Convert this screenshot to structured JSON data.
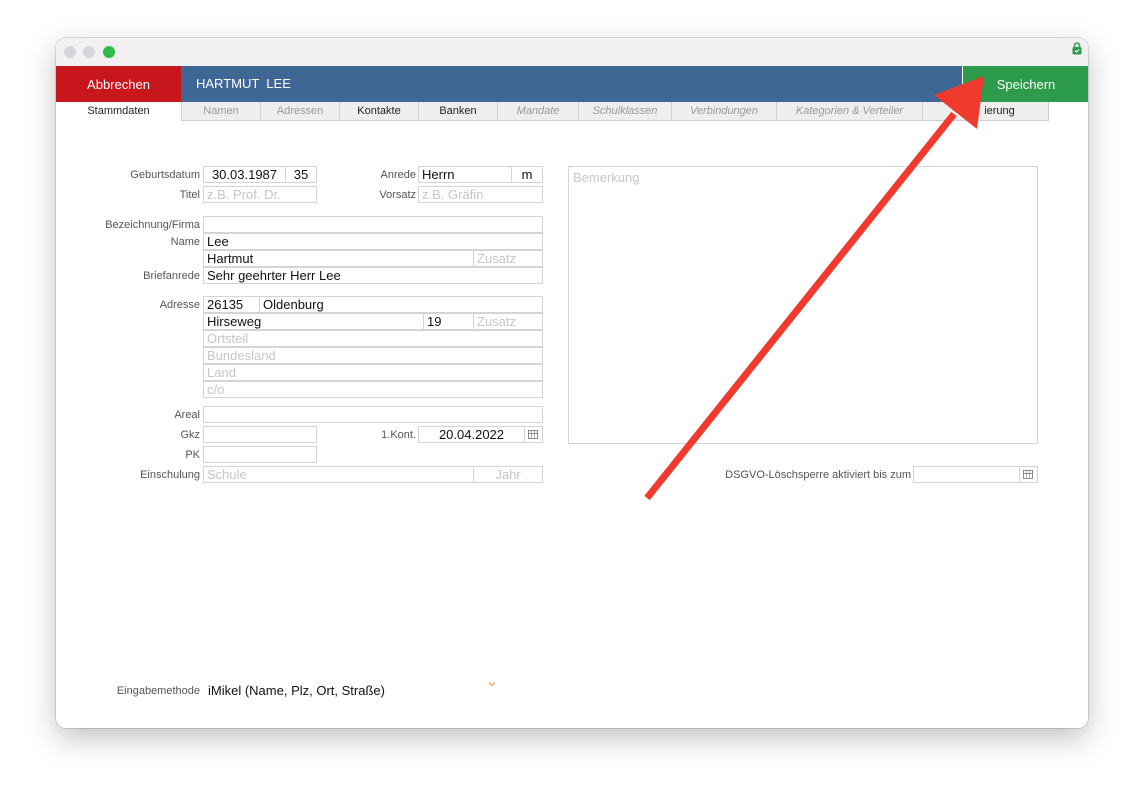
{
  "window": {
    "accent_close": "#c7171d",
    "accent_save": "#2d9b4c",
    "toolbar_color": "#3f6796"
  },
  "toolbar": {
    "cancel_label": "Abbrechen",
    "person_name": "HARTMUT  LEE",
    "save_label": "Speichern"
  },
  "tabs": [
    {
      "label": "Stammdaten"
    },
    {
      "label": "Namen"
    },
    {
      "label": "Adressen"
    },
    {
      "label": "Kontakte"
    },
    {
      "label": "Banken"
    },
    {
      "label": "Mandate"
    },
    {
      "label": "Schulklassen"
    },
    {
      "label": "Verbindungen"
    },
    {
      "label": "Kategorien & Verteiler"
    },
    {
      "label": "ierung"
    }
  ],
  "form": {
    "birthdate_label": "Geburtsdatum",
    "birthdate": "30.03.1987",
    "age": "35",
    "salutation_label": "Anrede",
    "salutation": "Herrn",
    "gender": "m",
    "title_label": "Titel",
    "title_placeholder": "z.B. Prof. Dr.",
    "prefix_label": "Vorsatz",
    "prefix_placeholder": "z.B. Gräfin",
    "company_label": "Bezeichnung/Firma",
    "company": "",
    "name_label": "Name",
    "last_name": "Lee",
    "first_name": "Hartmut",
    "name_suffix_placeholder": "Zusatz",
    "letter_salutation_label": "Briefanrede",
    "letter_salutation": "Sehr geehrter Herr Lee",
    "address_label": "Adresse",
    "zip": "26135",
    "city": "Oldenburg",
    "street": "Hirseweg",
    "house_number": "19",
    "address_suffix_placeholder": "Zusatz",
    "district_placeholder": "Ortsteil",
    "state_placeholder": "Bundesland",
    "country_placeholder": "Land",
    "care_of_placeholder": "c/o",
    "area_label": "Areal",
    "gkz_label": "Gkz",
    "first_contact_label": "1.Kont.",
    "first_contact": "20.04.2022",
    "pk_label": "PK",
    "schooling_label": "Einschulung",
    "school_placeholder": "Schule",
    "year_placeholder": "Jahr",
    "remark_placeholder": "Bemerkung",
    "gdpr_label": "DSGVO-Löschsperre aktiviert bis zum",
    "input_method_label": "Eingabemethode",
    "input_method": "iMikel (Name, Plz, Ort, Straße)"
  },
  "icons": [
    "lock-icon",
    "calendar-icon",
    "chevron-down-icon"
  ],
  "annotation": {
    "arrow_color": "#f03a2e"
  }
}
